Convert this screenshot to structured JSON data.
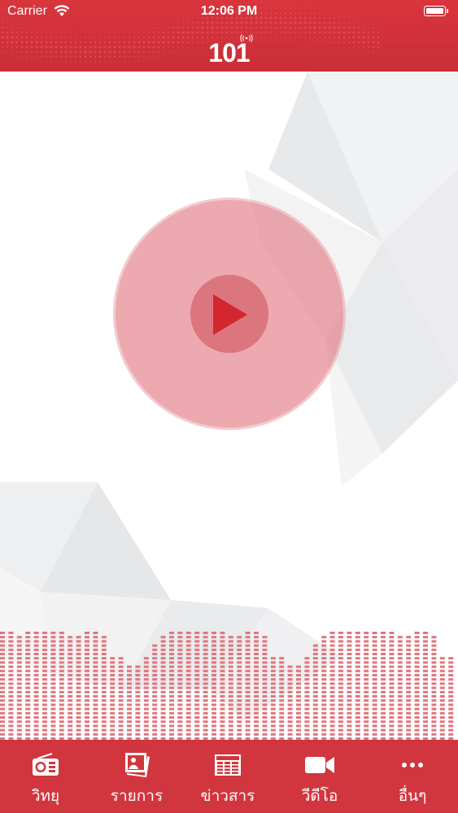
{
  "status_bar": {
    "carrier": "Carrier",
    "time": "12:06 PM"
  },
  "header": {
    "logo_text": "101",
    "color": "#d1363e"
  },
  "player": {
    "state": "paused",
    "play_icon": "play-icon",
    "outer_color": "#e0757e",
    "inner_color": "#cd4b55",
    "triangle_color": "#d3262f"
  },
  "equalizer": {
    "bar_color": "#e0757e",
    "levels": [
      11,
      12,
      10,
      11,
      12,
      13,
      15,
      11,
      10,
      10,
      12,
      15,
      10,
      8,
      8,
      7,
      7,
      8,
      9,
      10,
      11,
      12,
      11,
      12,
      13,
      15,
      13,
      10,
      10,
      11,
      15,
      10,
      8,
      8,
      7,
      7,
      8,
      9,
      10,
      11,
      12,
      11,
      12,
      13,
      15,
      13,
      11,
      10,
      10,
      11,
      15,
      10,
      8,
      8
    ]
  },
  "tabbar": {
    "background": "#d1363e",
    "items": [
      {
        "label": "วิทยุ",
        "icon": "radio-icon"
      },
      {
        "label": "รายการ",
        "icon": "photos-icon"
      },
      {
        "label": "ข่าวสาร",
        "icon": "newspaper-icon"
      },
      {
        "label": "วีดีโอ",
        "icon": "video-camera-icon"
      },
      {
        "label": "อื่นๆ",
        "icon": "more-icon"
      }
    ]
  }
}
